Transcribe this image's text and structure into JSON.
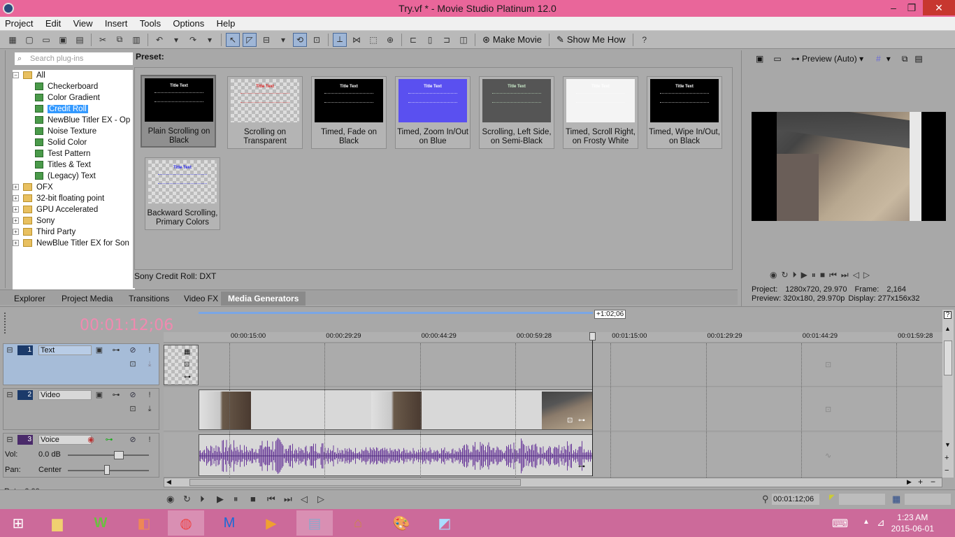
{
  "window": {
    "title": "Try.vf * - Movie Studio Platinum 12.0",
    "minimize": "–",
    "restore": "❐",
    "close": "✕"
  },
  "menu": [
    "Project",
    "Edit",
    "View",
    "Insert",
    "Tools",
    "Options",
    "Help"
  ],
  "toolbar": {
    "make_movie": "Make Movie",
    "show_me_how": "Show Me How"
  },
  "plugins": {
    "search_placeholder": "Search plug-ins",
    "tree": [
      {
        "label": "All",
        "level": 0,
        "type": "folder",
        "expander": "−"
      },
      {
        "label": "Checkerboard",
        "level": 1,
        "type": "plugin"
      },
      {
        "label": "Color Gradient",
        "level": 1,
        "type": "plugin"
      },
      {
        "label": "Credit Roll",
        "level": 1,
        "type": "plugin",
        "selected": true
      },
      {
        "label": "NewBlue Titler EX - Op",
        "level": 1,
        "type": "plugin"
      },
      {
        "label": "Noise Texture",
        "level": 1,
        "type": "plugin"
      },
      {
        "label": "Solid Color",
        "level": 1,
        "type": "plugin"
      },
      {
        "label": "Test Pattern",
        "level": 1,
        "type": "plugin"
      },
      {
        "label": "Titles & Text",
        "level": 1,
        "type": "plugin"
      },
      {
        "label": "(Legacy) Text",
        "level": 1,
        "type": "plugin"
      },
      {
        "label": "OFX",
        "level": 0,
        "type": "folder",
        "expander": "+"
      },
      {
        "label": "32-bit floating point",
        "level": 0,
        "type": "folder",
        "expander": "+"
      },
      {
        "label": "GPU Accelerated",
        "level": 0,
        "type": "folder",
        "expander": "+"
      },
      {
        "label": "Sony",
        "level": 0,
        "type": "folder",
        "expander": "+"
      },
      {
        "label": "Third Party",
        "level": 0,
        "type": "folder",
        "expander": "+"
      },
      {
        "label": "NewBlue Titler EX for Son",
        "level": 0,
        "type": "folder",
        "expander": "+"
      }
    ]
  },
  "presets": {
    "label": "Preset:",
    "status": "Sony Credit Roll: DXT",
    "items": [
      {
        "caption": "Plain Scrolling on Black",
        "bg": "#000000",
        "title_color": "#ffffff",
        "selected": true
      },
      {
        "caption": "Scrolling on Transparent",
        "bg": "checker",
        "title_color": "#dd2222"
      },
      {
        "caption": "Timed, Fade on Black",
        "bg": "#000000",
        "title_color": "#ffffff"
      },
      {
        "caption": "Timed, Zoom In/Out on Blue",
        "bg": "#5a50f0",
        "title_color": "#ffffff"
      },
      {
        "caption": "Scrolling, Left Side, on Semi-Black",
        "bg": "#555555",
        "title_color": "#cceecc"
      },
      {
        "caption": "Timed, Scroll Right, on Frosty White",
        "bg": "#f4f4f4",
        "title_color": "#ffffff"
      },
      {
        "caption": "Timed, Wipe In/Out, on Black",
        "bg": "#000000",
        "title_color": "#ffffff"
      },
      {
        "caption": "Backward Scrolling, Primary Colors",
        "bg": "checker",
        "title_color": "#2222ee"
      }
    ],
    "thumb_title": "Title Text"
  },
  "tabs": [
    "Explorer",
    "Project Media",
    "Transitions",
    "Video FX",
    "Media Generators"
  ],
  "active_tab": "Media Generators",
  "preview": {
    "mode": "Preview (Auto)",
    "project_label": "Project:",
    "project_value": "1280x720, 29.970",
    "frame_label": "Frame:",
    "frame_value": "2,164",
    "preview_label": "Preview:",
    "preview_value": "320x180, 29.970p",
    "display_label": "Display:",
    "display_value": "277x156x32"
  },
  "timeline": {
    "time": "00:01:12;06",
    "region_length": "+1:02;06",
    "ticks": [
      "00:00:15:00",
      "00:00:29:29",
      "00:00:44:29",
      "00:00:59:28",
      "00:01:15:00",
      "00:01:29:29",
      "00:01:44:29",
      "00:01:59:28"
    ],
    "tracks": [
      {
        "number": "1",
        "name": "Text",
        "kind": "video"
      },
      {
        "number": "2",
        "name": "Video",
        "kind": "video"
      },
      {
        "number": "3",
        "name": "Voice",
        "kind": "audio",
        "vol_label": "Vol:",
        "vol_value": "0.0 dB",
        "pan_label": "Pan:",
        "pan_value": "Center"
      }
    ],
    "rate_label": "Rate: 0.00"
  },
  "transport": {
    "timecode": "00:01:12;06"
  },
  "taskbar": {
    "time": "1:23 AM",
    "date": "2015-06-01"
  }
}
